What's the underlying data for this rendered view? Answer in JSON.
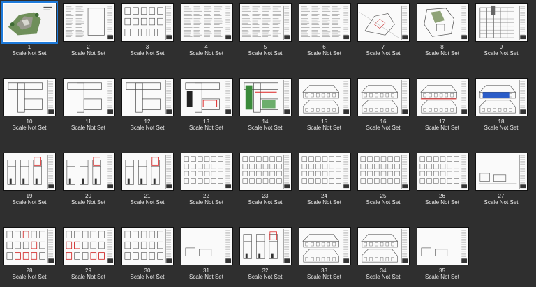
{
  "viewer": {
    "background": "#2f2f2f",
    "selected_color": "#1e7bdc"
  },
  "pages": [
    {
      "number": "1",
      "scale": "Scale Not Set",
      "kind": "render",
      "selected": true
    },
    {
      "number": "2",
      "scale": "Scale Not Set",
      "kind": "schedule"
    },
    {
      "number": "3",
      "scale": "Scale Not Set",
      "kind": "details"
    },
    {
      "number": "4",
      "scale": "Scale Not Set",
      "kind": "notes"
    },
    {
      "number": "5",
      "scale": "Scale Not Set",
      "kind": "notes"
    },
    {
      "number": "6",
      "scale": "Scale Not Set",
      "kind": "notes"
    },
    {
      "number": "7",
      "scale": "Scale Not Set",
      "kind": "site"
    },
    {
      "number": "8",
      "scale": "Scale Not Set",
      "kind": "siteplan"
    },
    {
      "number": "9",
      "scale": "Scale Not Set",
      "kind": "grid"
    },
    {
      "number": "10",
      "scale": "Scale Not Set",
      "kind": "plan"
    },
    {
      "number": "11",
      "scale": "Scale Not Set",
      "kind": "plan"
    },
    {
      "number": "12",
      "scale": "Scale Not Set",
      "kind": "plan"
    },
    {
      "number": "13",
      "scale": "Scale Not Set",
      "kind": "planred"
    },
    {
      "number": "14",
      "scale": "Scale Not Set",
      "kind": "plangreen"
    },
    {
      "number": "15",
      "scale": "Scale Not Set",
      "kind": "elevation"
    },
    {
      "number": "16",
      "scale": "Scale Not Set",
      "kind": "elevation"
    },
    {
      "number": "17",
      "scale": "Scale Not Set",
      "kind": "elevationred"
    },
    {
      "number": "18",
      "scale": "Scale Not Set",
      "kind": "elevationblue"
    },
    {
      "number": "19",
      "scale": "Scale Not Set",
      "kind": "section"
    },
    {
      "number": "20",
      "scale": "Scale Not Set",
      "kind": "section"
    },
    {
      "number": "21",
      "scale": "Scale Not Set",
      "kind": "section"
    },
    {
      "number": "22",
      "scale": "Scale Not Set",
      "kind": "windows"
    },
    {
      "number": "23",
      "scale": "Scale Not Set",
      "kind": "windows"
    },
    {
      "number": "24",
      "scale": "Scale Not Set",
      "kind": "windows"
    },
    {
      "number": "25",
      "scale": "Scale Not Set",
      "kind": "windows"
    },
    {
      "number": "26",
      "scale": "Scale Not Set",
      "kind": "windows"
    },
    {
      "number": "27",
      "scale": "Scale Not Set",
      "kind": "sparse"
    },
    {
      "number": "28",
      "scale": "Scale Not Set",
      "kind": "detailsred"
    },
    {
      "number": "29",
      "scale": "Scale Not Set",
      "kind": "detailsred"
    },
    {
      "number": "30",
      "scale": "Scale Not Set",
      "kind": "details"
    },
    {
      "number": "31",
      "scale": "Scale Not Set",
      "kind": "sparse"
    },
    {
      "number": "32",
      "scale": "Scale Not Set",
      "kind": "section"
    },
    {
      "number": "33",
      "scale": "Scale Not Set",
      "kind": "elevation"
    },
    {
      "number": "34",
      "scale": "Scale Not Set",
      "kind": "elevation"
    },
    {
      "number": "35",
      "scale": "Scale Not Set",
      "kind": "sparse"
    }
  ]
}
